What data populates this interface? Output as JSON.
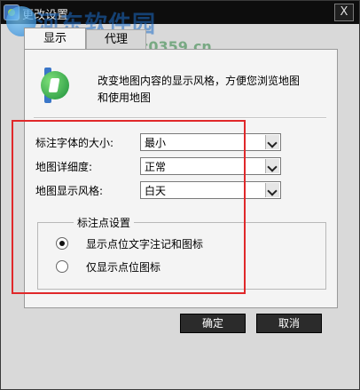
{
  "window": {
    "title": "更改设置",
    "close_glyph": "X"
  },
  "watermark": {
    "line1": "河东软件园",
    "line2": "www.pc0359.cn"
  },
  "tabs": [
    {
      "label": "显示"
    },
    {
      "label": "代理"
    }
  ],
  "description": "改变地图内容的显示风格，方便您浏览地图和使用地图",
  "settings": [
    {
      "label": "标注字体的大小:",
      "value": "最小"
    },
    {
      "label": "地图详细度:",
      "value": "正常"
    },
    {
      "label": "地图显示风格:",
      "value": "白天"
    }
  ],
  "poi_group": {
    "title": "标注点设置",
    "options": [
      {
        "label": "显示点位文字注记和图标",
        "selected": true
      },
      {
        "label": "仅显示点位图标",
        "selected": false
      }
    ]
  },
  "buttons": {
    "ok": "确定",
    "cancel": "取消"
  },
  "colors": {
    "highlight": "#e0282a",
    "titlebar": "#0d0d0d"
  }
}
